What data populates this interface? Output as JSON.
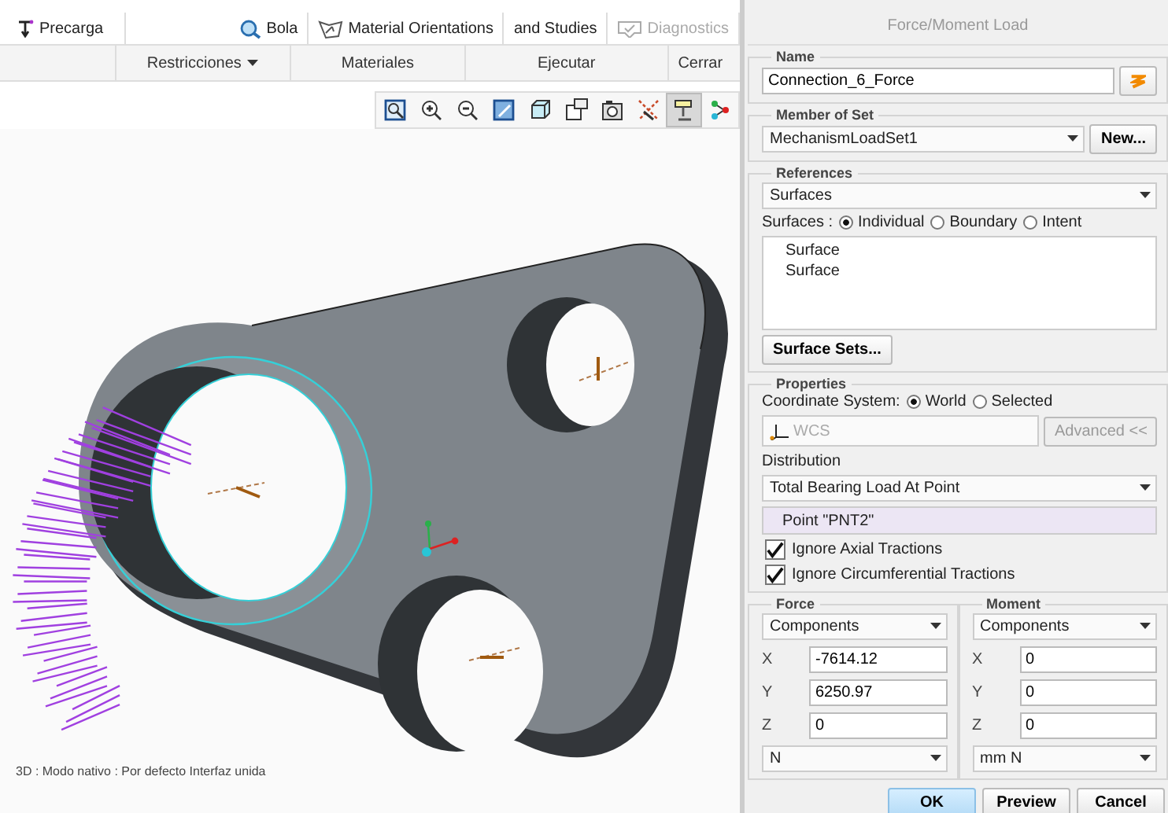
{
  "ribbon": {
    "top_items": [
      {
        "label": "Precarga",
        "disabled": false
      },
      {
        "label": "Bola",
        "disabled": false
      },
      {
        "label": "Material Orientations",
        "disabled": false
      },
      {
        "label": "and Studies",
        "disabled": false
      },
      {
        "label": "Diagnostics",
        "disabled": true
      }
    ],
    "groups": [
      {
        "label": "Restricciones",
        "has_menu": true
      },
      {
        "label": "Materiales",
        "has_menu": false
      },
      {
        "label": "Ejecutar",
        "has_menu": false
      },
      {
        "label": "Cerrar",
        "has_menu": false
      }
    ]
  },
  "view_toolbar": [
    {
      "pressed": false
    },
    {
      "pressed": false
    },
    {
      "pressed": false
    },
    {
      "pressed": false
    },
    {
      "pressed": false
    },
    {
      "pressed": false
    },
    {
      "pressed": false
    },
    {
      "pressed": false
    },
    {
      "pressed": true
    },
    {
      "pressed": false
    }
  ],
  "status_text": "3D : Modo nativo : Por defecto Interfaz unida",
  "dialog": {
    "title": "Force/Moment Load",
    "name": {
      "legend": "Name",
      "value": "Connection_6_Force"
    },
    "member_of_set": {
      "legend": "Member of Set",
      "value": "MechanismLoadSet1",
      "button": "New..."
    },
    "references": {
      "legend": "References",
      "type": "Surfaces",
      "radio_label": "Surfaces :",
      "options": [
        {
          "label": "Individual",
          "selected": true
        },
        {
          "label": "Boundary",
          "selected": false
        },
        {
          "label": "Intent",
          "selected": false
        }
      ],
      "items": [
        "Surface",
        "Surface"
      ],
      "button": "Surface Sets..."
    },
    "properties": {
      "legend": "Properties",
      "coord_label": "Coordinate System:",
      "coord_options": [
        {
          "label": "World",
          "selected": true
        },
        {
          "label": "Selected",
          "selected": false
        }
      ],
      "coord_value": "WCS",
      "advanced_button": "Advanced <<",
      "distribution_label": "Distribution",
      "distribution": "Total Bearing Load At Point",
      "point": "Point \"PNT2\"",
      "checks": [
        {
          "label": "Ignore Axial Tractions",
          "checked": true
        },
        {
          "label": "Ignore Circumferential Tractions",
          "checked": true
        }
      ]
    },
    "force": {
      "legend": "Force",
      "mode": "Components",
      "rows": [
        {
          "axis": "X",
          "value": "-7614.12"
        },
        {
          "axis": "Y",
          "value": "6250.97"
        },
        {
          "axis": "Z",
          "value": "0"
        }
      ],
      "units": "N"
    },
    "moment": {
      "legend": "Moment",
      "mode": "Components",
      "rows": [
        {
          "axis": "X",
          "value": "0"
        },
        {
          "axis": "Y",
          "value": "0"
        },
        {
          "axis": "Z",
          "value": "0"
        }
      ],
      "units": "mm N"
    },
    "buttons": [
      {
        "label": "OK",
        "default": true
      },
      {
        "label": "Preview",
        "default": false
      },
      {
        "label": "Cancel",
        "default": false
      }
    ]
  }
}
